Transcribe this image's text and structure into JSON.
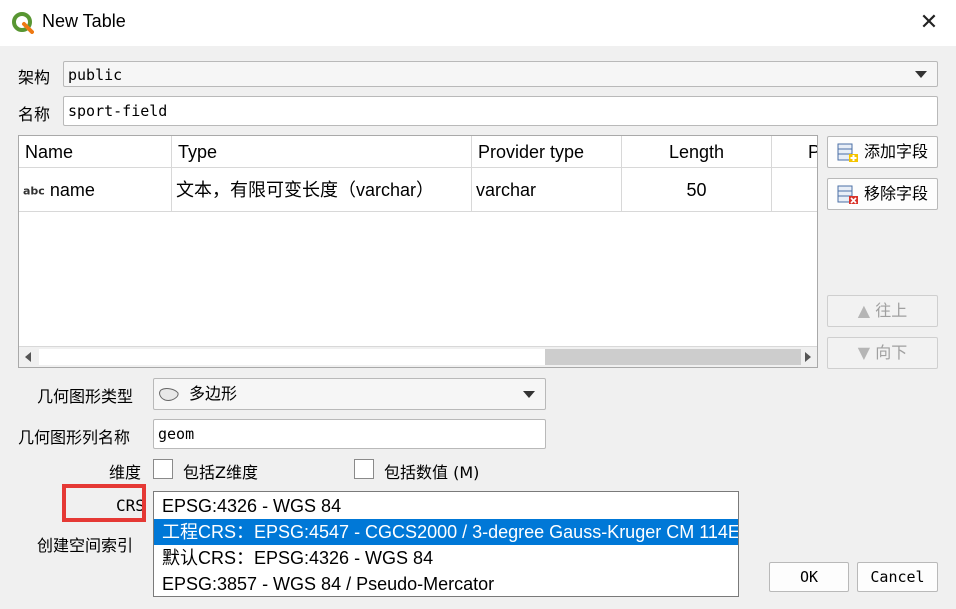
{
  "window": {
    "title": "New Table",
    "close_icon": "close-icon"
  },
  "schema": {
    "label": "架构",
    "value": "public"
  },
  "name": {
    "label": "名称",
    "value": "sport-field"
  },
  "fields_table": {
    "columns": [
      "Name",
      "Type",
      "Provider type",
      "Length",
      "P"
    ],
    "rows": [
      {
        "type_icon": "abc",
        "name": "name",
        "type": "文本，有限可变长度（varchar）",
        "provider_type": "varchar",
        "length": "50"
      }
    ]
  },
  "side_buttons": {
    "add": "添加字段",
    "remove": "移除字段",
    "up": "往上",
    "down": "向下"
  },
  "geometry_type": {
    "label": "几何图形类型",
    "value": "多边形"
  },
  "geometry_column": {
    "label": "几何图形列名称",
    "value": "geom"
  },
  "dimensions": {
    "label": "维度",
    "z_label": "包括Z维度",
    "m_label": "包括数值 (M)"
  },
  "crs": {
    "label": "CRS",
    "options": [
      "EPSG:4326 - WGS 84",
      "工程CRS：EPSG:4547 - CGCS2000 / 3-degree Gauss-Kruger CM 114E",
      "默认CRS：EPSG:4326 - WGS 84",
      "EPSG:3857 - WGS 84 / Pseudo-Mercator"
    ],
    "highlighted_index": 1
  },
  "spatial_index": {
    "label": "创建空间索引"
  },
  "footer": {
    "ok": "OK",
    "cancel": "Cancel"
  },
  "colors": {
    "highlight": "#0078d7",
    "annotation_box": "#e53935"
  }
}
